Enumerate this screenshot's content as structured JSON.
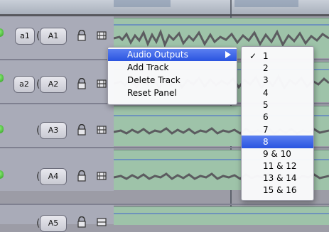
{
  "tracks": [
    {
      "source_label": "a1",
      "dest_label": "A1"
    },
    {
      "source_label": "a2",
      "dest_label": "A2"
    },
    {
      "source_label": "",
      "dest_label": "A3"
    },
    {
      "source_label": "",
      "dest_label": "A4"
    },
    {
      "source_label": "",
      "dest_label": "A5"
    }
  ],
  "context_menu": {
    "items": [
      "Audio Outputs",
      "Add Track",
      "Delete Track",
      "Reset Panel"
    ],
    "highlighted": "Audio Outputs"
  },
  "audio_outputs_submenu": {
    "items": [
      "1",
      "2",
      "3",
      "4",
      "5",
      "6",
      "7",
      "8",
      "9 & 10",
      "11 & 12",
      "13 & 14",
      "15 & 16"
    ],
    "checked": "1",
    "highlighted": "8"
  },
  "colors": {
    "clip_green": "#9ec3a9",
    "selection_blue": "#2a54e0",
    "panel_gray": "#a9abb8"
  },
  "icons": [
    "lock-icon",
    "auto-select-icon",
    "submenu-arrow-icon",
    "check-icon",
    "green-indicator-icon"
  ]
}
